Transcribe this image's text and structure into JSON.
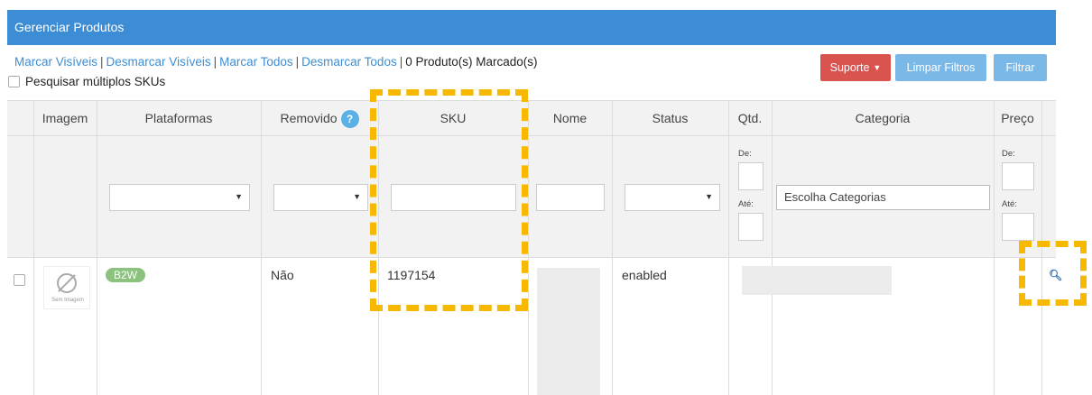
{
  "header": {
    "title": "Gerenciar Produtos",
    "color": "#3c8dd5"
  },
  "selection": {
    "links": [
      "Marcar Visíveis",
      "Desmarcar Visíveis",
      "Marcar Todos",
      "Desmarcar Todos"
    ],
    "count_text": "0 Produto(s) Marcado(s)",
    "multi_sku_label": "Pesquisar múltiplos SKUs"
  },
  "buttons": {
    "suporte": "Suporte",
    "limpar_filtros": "Limpar Filtros",
    "filtrar": "Filtrar"
  },
  "table": {
    "columns": {
      "imagem": "Imagem",
      "plataformas": "Plataformas",
      "removido": "Removido",
      "sku": "SKU",
      "nome": "Nome",
      "status": "Status",
      "qtd": "Qtd.",
      "categoria": "Categoria",
      "preco": "Preço"
    },
    "filters": {
      "de_label": "De:",
      "ate_label": "Até:",
      "categoria_value": "Escolha Categorias"
    },
    "rows": [
      {
        "image_caption": "Sem Imagem",
        "platform": "B2W",
        "removido": "Não",
        "sku": "1197154",
        "status": "enabled"
      }
    ]
  },
  "icons": {
    "help": "help-icon",
    "zoom": "zoom-icon",
    "no_image": "no-image-icon"
  },
  "colors": {
    "suporte": "#d9534f",
    "limpar_filtrar": "#7ab8e8",
    "badge": "#8bc27e",
    "highlight": "#f6b800"
  }
}
